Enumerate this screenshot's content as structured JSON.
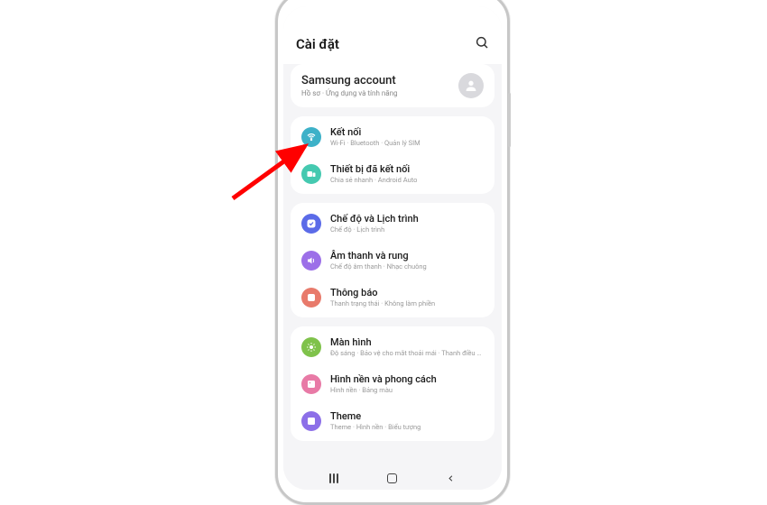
{
  "header": {
    "title": "Cài đặt"
  },
  "account": {
    "title": "Samsung account",
    "subtitle": "Hồ sơ · Ứng dụng và tính năng"
  },
  "groups": [
    {
      "id": "connectivity",
      "items": [
        {
          "id": "connections",
          "icon": "wifi",
          "color": "#3DB1C8",
          "title": "Kết nối",
          "subtitle": "Wi-Fi · Bluetooth · Quản lý SIM"
        },
        {
          "id": "connected-devices",
          "icon": "devices",
          "color": "#45C9B0",
          "title": "Thiết bị đã kết nối",
          "subtitle": "Chia sẻ nhanh · Android Auto"
        }
      ]
    },
    {
      "id": "sound-notify",
      "items": [
        {
          "id": "modes",
          "icon": "check",
          "color": "#5B6BE8",
          "title": "Chế độ và Lịch trình",
          "subtitle": "Chế độ · Lịch trình"
        },
        {
          "id": "sound",
          "icon": "sound",
          "color": "#9C6FE8",
          "title": "Âm thanh và rung",
          "subtitle": "Chế độ âm thanh · Nhạc chuông"
        },
        {
          "id": "notifications",
          "icon": "bell",
          "color": "#E87A6B",
          "title": "Thông báo",
          "subtitle": "Thanh trạng thái · Không làm phiền"
        }
      ]
    },
    {
      "id": "display",
      "items": [
        {
          "id": "display",
          "icon": "sun",
          "color": "#7FC24B",
          "title": "Màn hình",
          "subtitle": "Độ sáng · Bảo vệ cho mắt thoải mái · Thanh điều hướng"
        },
        {
          "id": "wallpaper",
          "icon": "picture",
          "color": "#E87AA6",
          "title": "Hình nền và phong cách",
          "subtitle": "Hình nền · Bảng màu"
        },
        {
          "id": "theme",
          "icon": "theme",
          "color": "#8C6FE8",
          "title": "Theme",
          "subtitle": "Theme · Hình nền · Biểu tượng"
        }
      ]
    }
  ]
}
